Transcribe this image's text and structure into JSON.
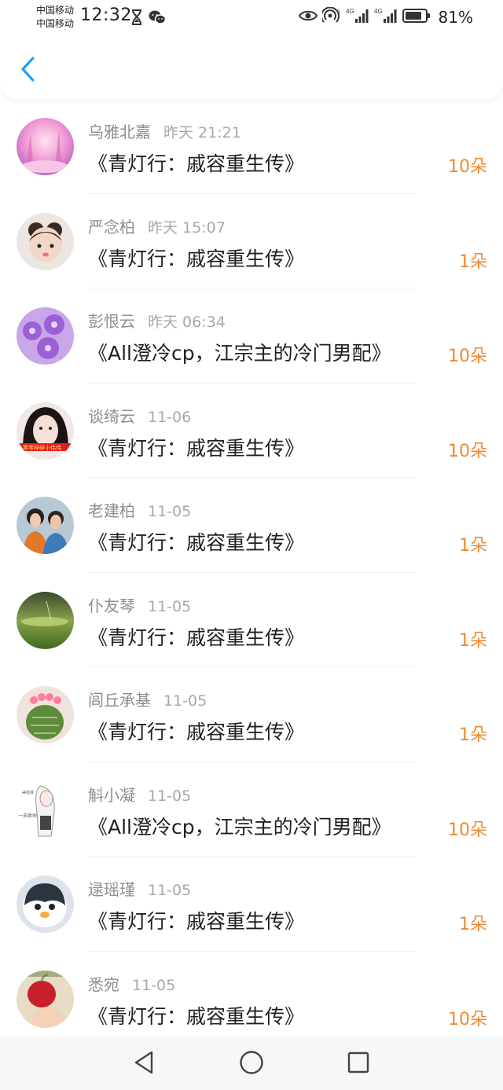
{
  "status_bar": {
    "carrier_1": "中国移动",
    "carrier_2": "中国移动",
    "time": "12:32",
    "battery": "81%",
    "network_1": "4G",
    "network_2": "4G"
  },
  "header": {
    "back_icon": "chevron-left-icon",
    "accent_color": "#2a9df4"
  },
  "list": [
    {
      "name": "乌雅北嘉",
      "date": "昨天 21:21",
      "title": "《青灯行：戚容重生传》",
      "count": "10朵",
      "avatar": "pink-forest"
    },
    {
      "name": "严念柏",
      "date": "昨天 15:07",
      "title": "《青灯行：戚容重生传》",
      "count": "1朵",
      "avatar": "baby-face"
    },
    {
      "name": "彭恨云",
      "date": "昨天 06:34",
      "title": "《All澄冷cp，江宗主的冷门男配》",
      "count": "10朵",
      "avatar": "purple-flowers"
    },
    {
      "name": "谈绮云",
      "date": "11-06",
      "title": "《青灯行：戚容重生传》",
      "count": "10朵",
      "avatar": "girl-portrait"
    },
    {
      "name": "老建柏",
      "date": "11-05",
      "title": "《青灯行：戚容重生传》",
      "count": "1朵",
      "avatar": "couple-photo"
    },
    {
      "name": "仆友琴",
      "date": "11-05",
      "title": "《青灯行：戚容重生传》",
      "count": "1朵",
      "avatar": "green-field"
    },
    {
      "name": "闾丘承基",
      "date": "11-05",
      "title": "《青灯行：戚容重生传》",
      "count": "1朵",
      "avatar": "cactus"
    },
    {
      "name": "斛小凝",
      "date": "11-05",
      "title": "《All澄冷cp，江宗主的冷门男配》",
      "count": "10朵",
      "avatar": "anime-sketch"
    },
    {
      "name": "逯瑶瑾",
      "date": "11-05",
      "title": "《青灯行：戚容重生传》",
      "count": "1朵",
      "avatar": "penguin"
    },
    {
      "name": "悉宛",
      "date": "11-05",
      "title": "《青灯行：戚容重生传》",
      "count": "10朵",
      "avatar": "apple-hand"
    }
  ],
  "navbar": {
    "back": "triangle-back-icon",
    "home": "circle-home-icon",
    "recents": "square-recents-icon"
  },
  "colors": {
    "count": "#f0892f",
    "name": "#8e8e8e",
    "title": "#1f1f1f"
  }
}
